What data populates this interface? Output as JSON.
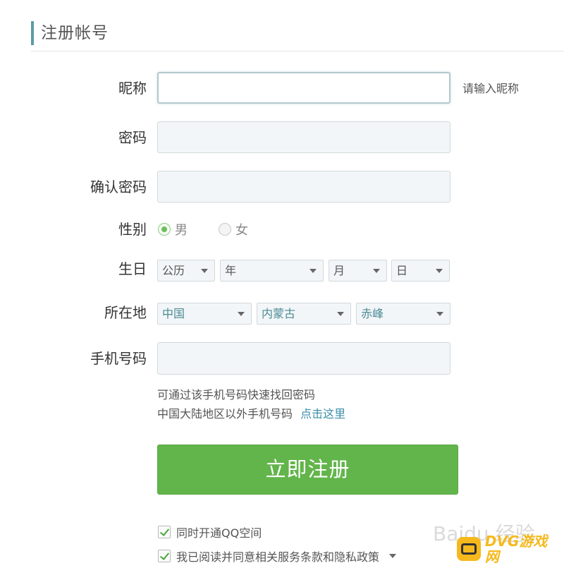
{
  "header": {
    "title": "注册帐号"
  },
  "form": {
    "nickname": {
      "label": "昵称",
      "value": "",
      "hint": "请输入昵称"
    },
    "password": {
      "label": "密码",
      "value": ""
    },
    "confirm_password": {
      "label": "确认密码",
      "value": ""
    },
    "gender": {
      "label": "性别",
      "options": [
        "男",
        "女"
      ],
      "selected": "男"
    },
    "birthday": {
      "label": "生日",
      "calendar": "公历",
      "year": "年",
      "month": "月",
      "day": "日"
    },
    "location": {
      "label": "所在地",
      "country": "中国",
      "province": "内蒙古",
      "city": "赤峰"
    },
    "phone": {
      "label": "手机号码",
      "value": "",
      "note1": "可通过该手机号码快速找回密码",
      "note2": "中国大陆地区以外手机号码",
      "link": "点击这里"
    },
    "register_button": "立即注册",
    "checkbox_qzone": {
      "label": "同时开通QQ空间",
      "checked": true
    },
    "checkbox_terms": {
      "label": "我已阅读并同意相关服务条款和隐私政策",
      "checked": true
    }
  },
  "watermarks": {
    "baidu": "Baidu 经验",
    "dvg": "DVG游戏网"
  },
  "colors": {
    "accent_green": "#62b54a",
    "link_blue": "#3b8ea8",
    "title_bar": "#5d9aa7"
  }
}
